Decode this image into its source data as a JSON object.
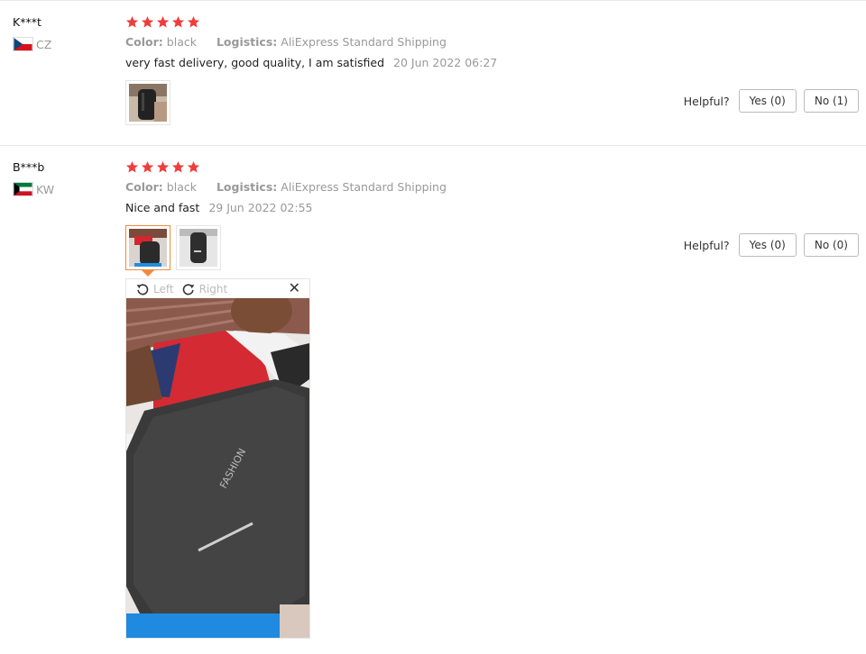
{
  "reviews": [
    {
      "user": "K***t",
      "country": "CZ",
      "rating": 5,
      "color_label": "Color:",
      "color_value": "black",
      "logistics_label": "Logistics:",
      "logistics_value": "AliExpress Standard Shipping",
      "text": "very fast delivery, good quality, I am satisfied",
      "date": "20 Jun 2022 06:27",
      "helpful_label": "Helpful?",
      "yes_label": "Yes (0)",
      "no_label": "No (1)"
    },
    {
      "user": "B***b",
      "country": "KW",
      "rating": 5,
      "color_label": "Color:",
      "color_value": "black",
      "logistics_label": "Logistics:",
      "logistics_value": "AliExpress Standard Shipping",
      "text": "Nice and fast",
      "date": "29 Jun 2022 02:55",
      "helpful_label": "Helpful?",
      "yes_label": "Yes (0)",
      "no_label": "No (0)"
    }
  ],
  "viewer": {
    "rotate_left_label": "Left",
    "rotate_right_label": "Right",
    "close_symbol": "✕",
    "photo_print": "FASHION"
  },
  "icons": {
    "star": "star-icon",
    "rotate_left": "rotate-left-icon",
    "rotate_right": "rotate-right-icon",
    "close": "close-icon"
  },
  "colors": {
    "star": "#f03c3c",
    "active_thumb": "#f08c3c",
    "muted_text": "#999999"
  }
}
